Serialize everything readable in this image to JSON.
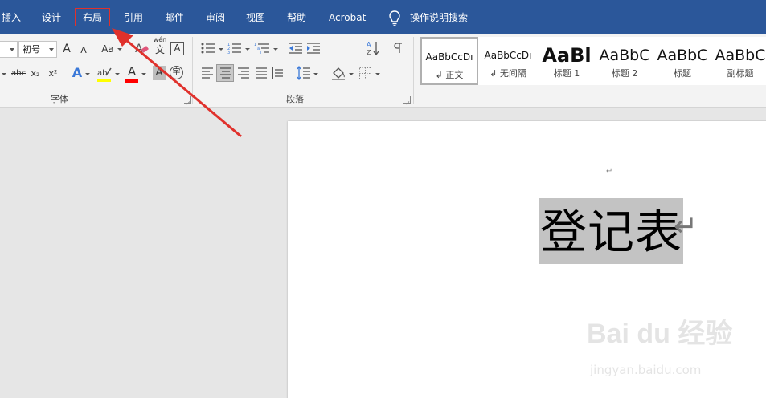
{
  "tabs": [
    {
      "label": "插入"
    },
    {
      "label": "设计"
    },
    {
      "label": "布局"
    },
    {
      "label": "引用"
    },
    {
      "label": "邮件"
    },
    {
      "label": "审阅"
    },
    {
      "label": "视图"
    },
    {
      "label": "帮助"
    },
    {
      "label": "Acrobat"
    },
    {
      "label": "操作说明搜索"
    }
  ],
  "highlighted_tab": "布局",
  "font_group": {
    "label": "字体",
    "font_size_value": "初号",
    "grow_font": "A",
    "shrink_font": "A",
    "change_case": "Aa",
    "phonetic": "wén",
    "phonetic_char": "文",
    "char_border": "A",
    "strikethrough": "abc",
    "subscript": "x₂",
    "superscript": "x²",
    "text_effects": "A",
    "highlight_color": "#ffff00",
    "font_color": "A",
    "font_color_value": "#ff0000",
    "char_shading": "A",
    "enclose_char": "字"
  },
  "paragraph_group": {
    "label": "段落"
  },
  "styles_gallery": [
    {
      "sample": "AaBbCcDı",
      "name": "↲ 正文",
      "size": 12
    },
    {
      "sample": "AaBbCcDı",
      "name": "↲ 无间隔",
      "size": 12
    },
    {
      "sample": "AaBl",
      "name": "标题 1",
      "size": 24
    },
    {
      "sample": "AaBbC",
      "name": "标题 2",
      "size": 19
    },
    {
      "sample": "AaBbC",
      "name": "标题",
      "size": 19
    },
    {
      "sample": "AaBbC",
      "name": "副标题",
      "size": 19
    }
  ],
  "document": {
    "small_mark": "↵",
    "title": "登记表",
    "title_mark": "↵"
  },
  "watermark": {
    "logo": "Bai du 经验",
    "site": "jingyan.baidu.com"
  },
  "colors": {
    "tabbar": "#2b579a",
    "ribbon": "#f3f3f3",
    "annotation": "#e0312c",
    "selection": "#c3c3c3"
  }
}
